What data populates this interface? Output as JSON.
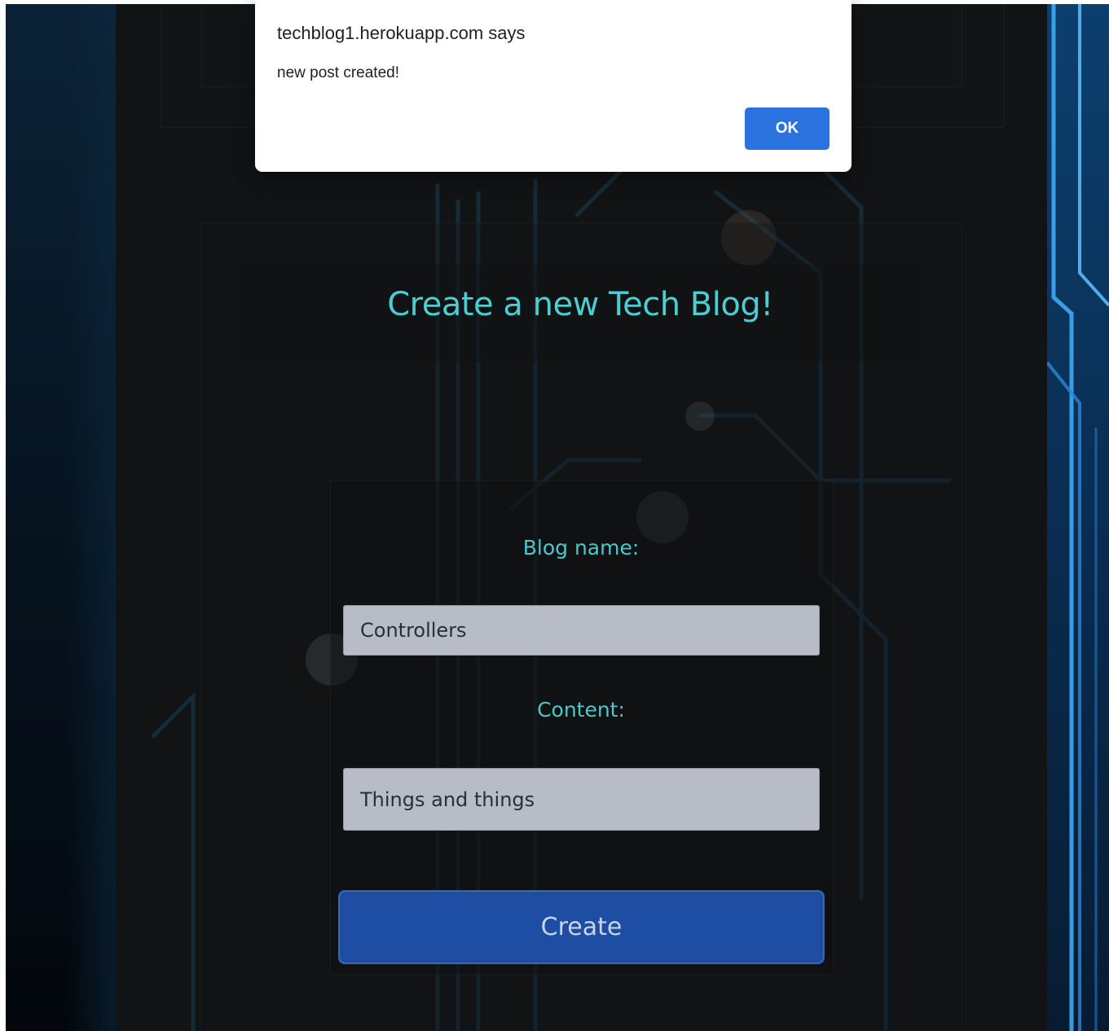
{
  "dialog": {
    "title": "techblog1.herokuapp.com says",
    "message": "new post created!",
    "ok_label": "OK"
  },
  "page": {
    "title": "Create a new Tech Blog!"
  },
  "form": {
    "name_label": "Blog name:",
    "name_value": "Controllers",
    "content_label": "Content:",
    "content_value": "Things and things",
    "submit_label": "Create"
  },
  "colors": {
    "accent_teal": "#4ccdd0",
    "button_blue": "#1d4ea3",
    "dialog_ok_blue": "#2a73de",
    "field_gray": "#b7bcc7"
  }
}
